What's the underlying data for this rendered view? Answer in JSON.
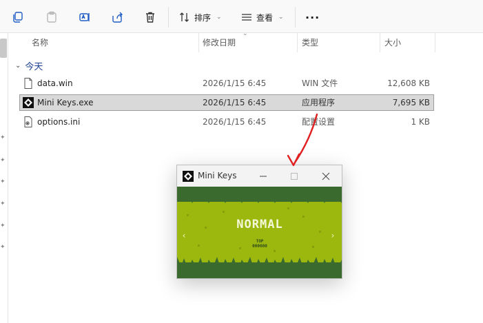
{
  "toolbar": {
    "icons": [
      "new-copy-icon",
      "paste-icon",
      "rename-icon",
      "share-icon",
      "delete-icon"
    ],
    "sort_label": "排序",
    "view_label": "查看",
    "more_label": "···"
  },
  "columns": {
    "name": "名称",
    "date": "修改日期",
    "type": "类型",
    "size": "大小"
  },
  "group": {
    "label": "今天"
  },
  "files": [
    {
      "name": "data.win",
      "date": "2026/1/15 6:45",
      "type": "WIN 文件",
      "size": "12,608 KB",
      "icon": "file-icon",
      "selected": false
    },
    {
      "name": "Mini Keys.exe",
      "date": "2026/1/15 6:45",
      "type": "应用程序",
      "size": "7,695 KB",
      "icon": "app-icon",
      "selected": true
    },
    {
      "name": "options.ini",
      "date": "2026/1/15 6:45",
      "type": "配置设置",
      "size": "1 KB",
      "icon": "settings-file-icon",
      "selected": false
    }
  ],
  "mini_keys": {
    "title": "Mini Keys",
    "mode_text": "NORMAL",
    "top_label": "TOP",
    "score": "000000",
    "prev_arrow": "‹",
    "next_arrow": "›",
    "colors": {
      "grass_light": "#9cb80e",
      "grass_dark": "#3b6a2e",
      "border_dark": "#2f5a2c"
    }
  },
  "annotation": {
    "color": "#e02020"
  }
}
